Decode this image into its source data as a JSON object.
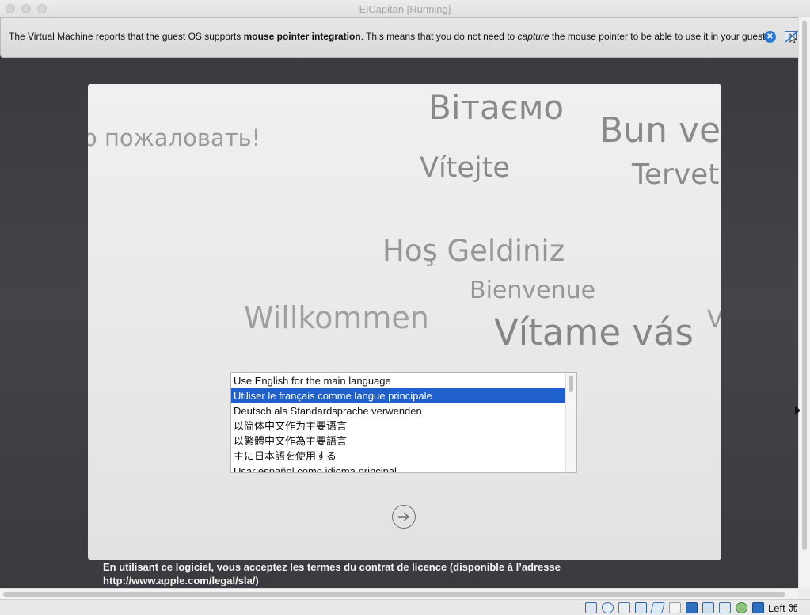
{
  "window": {
    "title": "ElCapitan [Running]"
  },
  "notice": {
    "text_before": "The Virtual Machine reports that the guest OS supports ",
    "bold": "mouse pointer integration",
    "text_mid": ". This means that you do not need to ",
    "italic": "capture",
    "text_after": " the mouse pointer to be able to use it in your guest",
    "close_icon": "close-circle-icon",
    "disable_icon": "mouse-integration-off-icon"
  },
  "greetings": [
    {
      "text": "Вітаємо"
    },
    {
      "text": "о пожаловать!"
    },
    {
      "text": "Bun ve"
    },
    {
      "text": "Vítejte"
    },
    {
      "text": "Tervetu"
    },
    {
      "text": "Hoş Geldiniz"
    },
    {
      "text": "Bienvenue"
    },
    {
      "text": "Willkommen"
    },
    {
      "text": "Vítame vás"
    },
    {
      "text": "V"
    }
  ],
  "languages": [
    {
      "label": "Use English for the main language",
      "selected": false
    },
    {
      "label": "Utiliser le français comme langue principale",
      "selected": true
    },
    {
      "label": "Deutsch als Standardsprache verwenden",
      "selected": false
    },
    {
      "label": "以简体中文作为主要语言",
      "selected": false
    },
    {
      "label": "以繁體中文作為主要語言",
      "selected": false
    },
    {
      "label": "主に日本語を使用する",
      "selected": false
    },
    {
      "label": "Usar español como idioma principal",
      "selected": false
    }
  ],
  "next_icon": "arrow-right-circle-icon",
  "license": "En utilisant ce logiciel, vous acceptez les termes du contrat de licence (disponible à l’adresse http://www.apple.com/legal/sla/)",
  "statusbar": {
    "icons": [
      "hard-disk-icon",
      "optical-disk-icon",
      "audio-icon",
      "network-icon",
      "usb-icon",
      "shared-folder-icon",
      "display-icon",
      "video-capture-icon",
      "cpu-icon",
      "recording-icon",
      "arrow-down-icon"
    ],
    "host_key": "Left ⌘"
  },
  "colors": {
    "selection": "#1f5fce",
    "close_button": "#2a79d3",
    "vm_background": "#404044"
  }
}
